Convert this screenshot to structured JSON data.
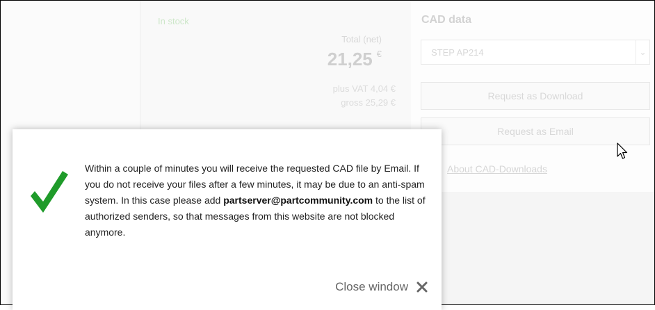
{
  "product": {
    "stock_status": "In stock",
    "total_label": "Total (net)",
    "total_price": "21,25",
    "currency": "€",
    "vat_line": "plus VAT 4,04 €",
    "gross_line": "gross 25,29 €"
  },
  "cad": {
    "title": "CAD data",
    "format_selected": "STEP AP214",
    "request_download_label": "Request as Download",
    "request_email_label": "Request as Email",
    "about_link": "About CAD-Downloads"
  },
  "dialog": {
    "message_part1": "Within a couple of minutes you will receive the requested CAD file by Email. If you do not receive your files after a few minutes, it may be due to an anti-spam system. In this case please add ",
    "email": "partserver@partcommunity.com",
    "message_part2": " to the list of authorized senders, so that messages from this website are not blocked anymore.",
    "close_label": "Close window"
  },
  "colors": {
    "check_green": "#1f9b2a",
    "close_x": "#666666"
  },
  "icons": [
    "checkmark-icon",
    "close-icon",
    "chevron-down-icon",
    "mouse-pointer-icon"
  ]
}
